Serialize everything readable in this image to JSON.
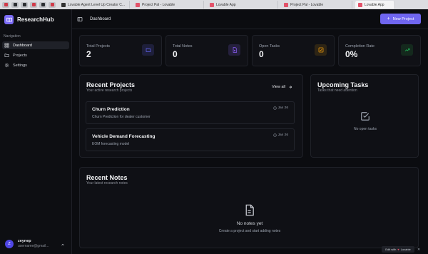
{
  "browser": {
    "tabs": [
      {
        "label": "Lovable Agent Level Up Creator C..."
      },
      {
        "label": "Project Pal - Lovable"
      },
      {
        "label": "Lovable App"
      },
      {
        "label": "Project Pal - Lovable"
      },
      {
        "label": "Lovable App"
      }
    ]
  },
  "sidebar": {
    "brand": "ResearchHub",
    "section_title": "Navigation",
    "items": [
      {
        "label": "Dashboard",
        "icon": "dashboard-icon",
        "active": true
      },
      {
        "label": "Projects",
        "icon": "folder-icon",
        "active": false
      },
      {
        "label": "Settings",
        "icon": "gear-icon",
        "active": false
      }
    ],
    "user": {
      "initial": "Z",
      "name": "zeynep",
      "email": "username@gmail..."
    }
  },
  "header": {
    "breadcrumb": "Dashboard",
    "new_project_label": "New Project"
  },
  "stats": [
    {
      "label": "Total Projects",
      "value": "2",
      "icon": "folder-icon",
      "color": "#6366f1"
    },
    {
      "label": "Total Notes",
      "value": "0",
      "icon": "file-icon",
      "color": "#8b5cf6"
    },
    {
      "label": "Open Tasks",
      "value": "0",
      "icon": "checkbox-icon",
      "color": "#f59e0b"
    },
    {
      "label": "Completion Rate",
      "value": "0%",
      "icon": "trending-up-icon",
      "color": "#22c55e"
    }
  ],
  "recent_projects": {
    "title": "Recent Projects",
    "subtitle": "Your active research projects",
    "view_all": "View all",
    "items": [
      {
        "name": "Churn Prediction",
        "description": "Churn Prediction for dealer customer",
        "date": "Jan 26"
      },
      {
        "name": "Vehicle Demand Forecasting",
        "description": "EOM forecasting model",
        "date": "Jan 26"
      }
    ]
  },
  "upcoming_tasks": {
    "title": "Upcoming Tasks",
    "subtitle": "Tasks that need attention",
    "empty": "No open tasks"
  },
  "recent_notes": {
    "title": "Recent Notes",
    "subtitle": "Your latest research notes",
    "empty_title": "No notes yet",
    "empty_body": "Create a project and start adding notes"
  },
  "badge": {
    "prefix": "Edit with",
    "brand": "Lovable"
  },
  "colors": {
    "accent": "#7066f0",
    "background": "#0b0c10",
    "card": "#101116",
    "border": "#1f2128"
  }
}
